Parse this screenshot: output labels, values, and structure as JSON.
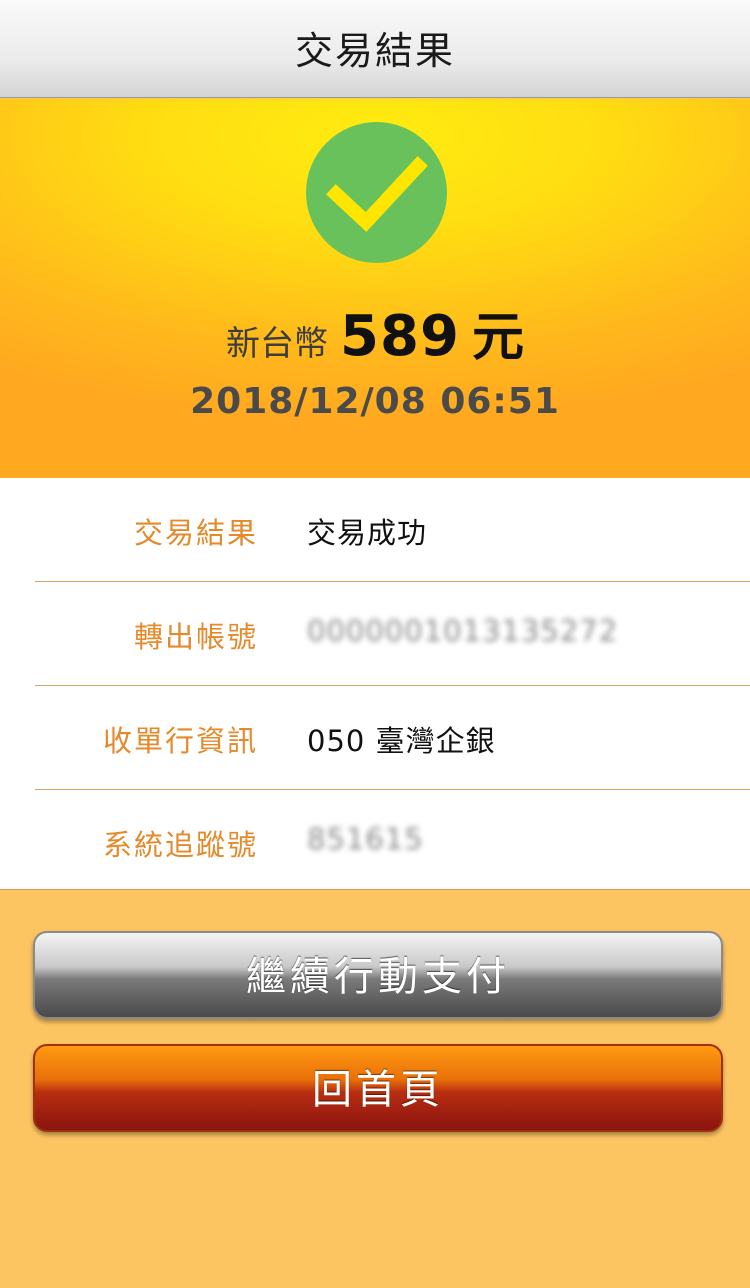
{
  "nav": {
    "title": "交易結果"
  },
  "summary": {
    "currency_label": "新台幣",
    "amount": "589",
    "unit": "元",
    "datetime": "2018/12/08 06:51",
    "status_icon": "check-icon",
    "status_color": "#69c15b"
  },
  "details": [
    {
      "label": "交易結果",
      "value": "交易成功",
      "obscured": false
    },
    {
      "label": "轉出帳號",
      "value": "0000001013135272",
      "obscured": true
    },
    {
      "label": "收單行資訊",
      "value": "050 臺灣企銀",
      "obscured": false
    },
    {
      "label": "系統追蹤號",
      "value": "851615",
      "obscured": true
    }
  ],
  "actions": {
    "continue_label": "繼續行動支付",
    "home_label": "回首頁"
  }
}
